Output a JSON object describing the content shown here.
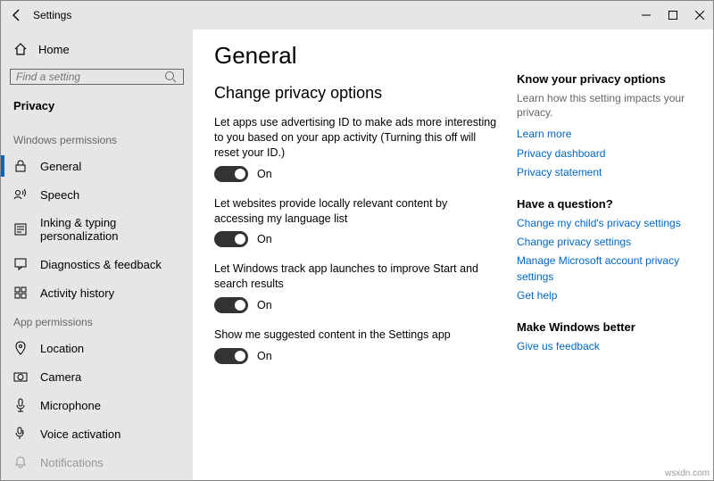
{
  "window": {
    "title": "Settings"
  },
  "sidebar": {
    "home": "Home",
    "search_placeholder": "Find a setting",
    "breadcrumb": "Privacy",
    "group1_label": "Windows permissions",
    "group1": [
      {
        "label": "General"
      },
      {
        "label": "Speech"
      },
      {
        "label": "Inking & typing personalization"
      },
      {
        "label": "Diagnostics & feedback"
      },
      {
        "label": "Activity history"
      }
    ],
    "group2_label": "App permissions",
    "group2": [
      {
        "label": "Location"
      },
      {
        "label": "Camera"
      },
      {
        "label": "Microphone"
      },
      {
        "label": "Voice activation"
      },
      {
        "label": "Notifications"
      }
    ]
  },
  "main": {
    "heading": "General",
    "subheading": "Change privacy options",
    "options": [
      {
        "desc": "Let apps use advertising ID to make ads more interesting to you based on your app activity (Turning this off will reset your ID.)",
        "state": "On"
      },
      {
        "desc": "Let websites provide locally relevant content by accessing my language list",
        "state": "On"
      },
      {
        "desc": "Let Windows track app launches to improve Start and search results",
        "state": "On"
      },
      {
        "desc": "Show me suggested content in the Settings app",
        "state": "On"
      }
    ]
  },
  "right": {
    "h1": "Know your privacy options",
    "t1": "Learn how this setting impacts your privacy.",
    "links1": [
      "Learn more",
      "Privacy dashboard",
      "Privacy statement"
    ],
    "h2": "Have a question?",
    "links2": [
      "Change my child's privacy settings",
      "Change privacy settings",
      "Manage Microsoft account privacy settings",
      "Get help"
    ],
    "h3": "Make Windows better",
    "links3": [
      "Give us feedback"
    ]
  },
  "watermark": "wsxdn.com"
}
